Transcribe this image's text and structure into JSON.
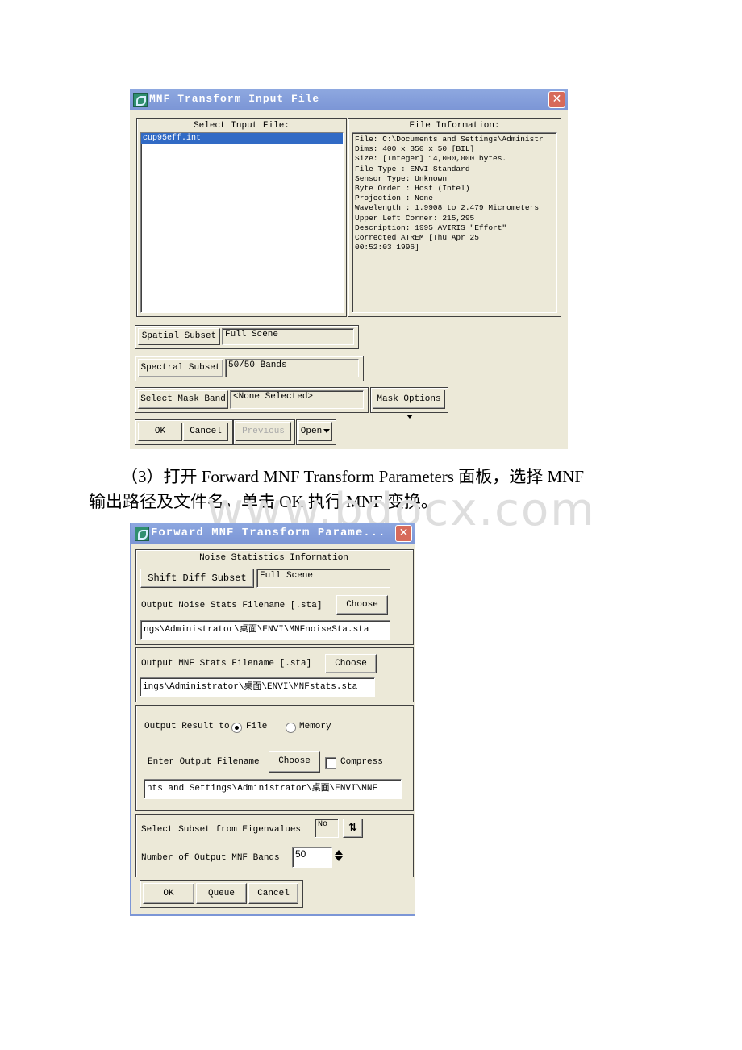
{
  "watermark": "www.bdocx.com",
  "dialog1": {
    "title": "MNF Transform Input File",
    "select_input_label": "Select Input File:",
    "files": [
      "cup95eff.int"
    ],
    "selected_file": "cup95eff.int",
    "file_info_label": "File Information:",
    "file_info": [
      "File: C:\\Documents and Settings\\Administr",
      "Dims: 400 x 350 x 50 [BIL]",
      "Size: [Integer] 14,000,000 bytes.",
      "File Type  : ENVI Standard",
      "Sensor Type: Unknown",
      "Byte Order : Host (Intel)",
      "Projection : None",
      "Wavelength : 1.9908 to 2.479 Micrometers",
      "Upper Left Corner: 215,295",
      "Description: 1995 AVIRIS \"Effort\"",
      "Corrected ATREM [Thu Apr 25",
      "00:52:03 1996]"
    ],
    "spatial_subset_button": "Spatial Subset",
    "spatial_subset_value": "Full Scene",
    "spectral_subset_button": "Spectral Subset",
    "spectral_subset_value": "50/50 Bands",
    "mask_band_button": "Select Mask Band",
    "mask_band_value": "<None Selected>",
    "mask_options_button": "Mask Options",
    "ok_button": "OK",
    "cancel_button": "Cancel",
    "previous_button": "Previous",
    "open_button": "Open"
  },
  "paragraph": {
    "line1": "（3）打开 Forward MNF Transform Parameters 面板，选择 MNF",
    "line2": "输出路径及文件名，单击 OK 执行 MNF 变换。"
  },
  "dialog2": {
    "title": "Forward MNF Transform Parame...",
    "noise_section_label": "Noise Statistics Information",
    "shift_diff_button": "Shift Diff Subset",
    "shift_diff_value": "Full Scene",
    "noise_stats_label": "Output Noise Stats Filename [.sta]",
    "noise_stats_choose": "Choose",
    "noise_stats_path": "ngs\\Administrator\\桌面\\ENVI\\MNFnoiseSta.sta",
    "mnf_stats_label": "Output MNF Stats Filename [.sta]",
    "mnf_stats_choose": "Choose",
    "mnf_stats_path": "ings\\Administrator\\桌面\\ENVI\\MNFstats.sta",
    "output_result_label": "Output Result to",
    "radio_file": "File",
    "radio_memory": "Memory",
    "output_selected": "File",
    "output_filename_label": "Enter Output Filename",
    "output_filename_choose": "Choose",
    "compress_label": "Compress",
    "compress_checked": false,
    "output_path": "nts and Settings\\Administrator\\桌面\\ENVI\\MNF",
    "eigen_label": "Select Subset from Eigenvalues",
    "eigen_value": "No",
    "bands_label": "Number of Output MNF Bands",
    "bands_value": "50",
    "ok_button": "OK",
    "queue_button": "Queue",
    "cancel_button": "Cancel"
  }
}
